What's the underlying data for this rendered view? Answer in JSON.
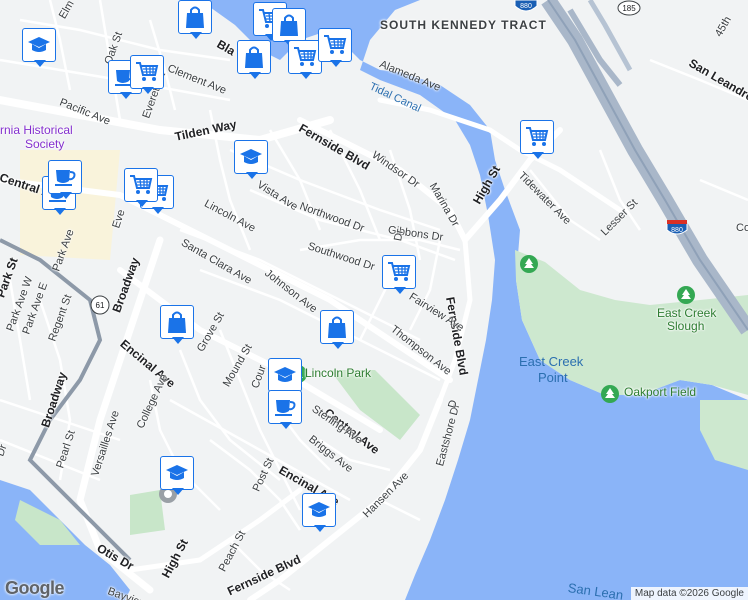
{
  "map": {
    "attribution": "Map data ©2026 Google",
    "logo": "Google",
    "colors": {
      "water": "#8ab4f8",
      "land": "#f1f3f4",
      "park": "#c8e6c9",
      "freeway": "#a9b7c9",
      "road": "#ffffff",
      "marker": "#1a73e8"
    }
  },
  "labels": {
    "district": "SOUTH KENNEDY TRACT",
    "historical_1": "rnia Historical",
    "historical_2": "Society",
    "tidal_canal": "Tidal Canal",
    "east_creek_point_1": "East Creek",
    "east_creek_point_2": "Point",
    "east_creek_slough_1": "East Creek",
    "east_creek_slough_2": "Slough",
    "oakport_field": "Oakport Field",
    "lincoln_park": "Lincoln Park",
    "san_leandro_bottom": "San Lean",
    "elm": "Elm St",
    "oak": "Oak St",
    "clement": "Clement Ave",
    "everett_top": "Everett St",
    "pacific": "Pacific Ave",
    "blanding": "Bla",
    "alameda_ave": "Alameda Ave",
    "tilden": "Tilden Way",
    "fernside_top": "Fernside Blvd",
    "windsor": "Windsor Dr",
    "marina": "Marina Dr",
    "high_st_right": "High St",
    "high_st_bottom": "High St",
    "tidewater": "Tidewater Ave",
    "lesser": "Lesser St",
    "san_leandro_top": "San Leandro S",
    "street_45th": "45th",
    "central_left": "Central Av",
    "central_bottom": "Central Ave",
    "vista": "Vista Ave",
    "northwood": "Northwood Dr",
    "gibbons": "Gibbons Dr",
    "southwood": "Southwood Dr",
    "dr_small": "Dr",
    "lincoln": "Lincoln Ave",
    "everett_mid": "Eve",
    "santa_clara": "Santa Clara Ave",
    "johnson": "Johnson Ave",
    "fernside_right": "Fernside Blvd",
    "fairview": "Fairview Ave",
    "thompson": "Thompson Ave",
    "park_st": "Park St",
    "park_ave": "Park Ave",
    "park_ave_w": "Park Ave W",
    "park_ave_e": "Park Ave E",
    "regent": "Regent St",
    "broadway_top": "Broadway",
    "broadway_left": "Broadway",
    "encinal_left": "Encinal Ave",
    "encinal_bottom": "Encinal Ave",
    "grove": "Grove St",
    "mound": "Mound St",
    "college": "College Ave",
    "versailles": "Versailles Ave",
    "pearl": "Pearl St",
    "sterling": "Sterling Ave",
    "briggs": "Briggs Ave",
    "court": "Cour",
    "post": "Post St",
    "peach": "Peach St",
    "hansen": "Hansen Ave",
    "eastshore": "Eastshore Dr",
    "otis": "Otis Dr",
    "bayview": "Bayview Dr",
    "fernside_bottom": "Fernside Blvd",
    "dr_left": "Dr",
    "dr_right": "D",
    "co": "Co",
    "shield_880_top": "880",
    "shield_880_right": "880",
    "shield_185": "185",
    "shield_61": "61"
  },
  "markers": [
    {
      "kind": "shopping-cart",
      "stack": 1
    },
    {
      "kind": "shopping-bag",
      "stack": 1
    },
    {
      "kind": "coffee",
      "stack": 1
    },
    {
      "kind": "school",
      "stack": 1
    },
    {
      "kind": "shopping-cart",
      "stack": 1
    },
    {
      "kind": "shopping-bag",
      "stack": 1
    },
    {
      "kind": "shopping-cart",
      "stack": 1
    },
    {
      "kind": "school",
      "stack": 1
    },
    {
      "kind": "coffee",
      "stack": 1
    },
    {
      "kind": "shopping-cart",
      "stack": 1
    },
    {
      "kind": "coffee",
      "stack": 1
    },
    {
      "kind": "shopping-cart",
      "stack": 1
    },
    {
      "kind": "shopping-cart",
      "stack": 1
    },
    {
      "kind": "shopping-cart",
      "stack": 1
    },
    {
      "kind": "shopping-bag",
      "stack": 1
    },
    {
      "kind": "shopping-bag",
      "stack": 1
    },
    {
      "kind": "school",
      "stack": 1
    },
    {
      "kind": "coffee",
      "stack": 1
    },
    {
      "kind": "school",
      "stack": 1
    },
    {
      "kind": "school",
      "stack": 1
    },
    {
      "kind": "shopping-bag",
      "stack": 1
    },
    {
      "kind": "shopping-cart",
      "stack": 1
    }
  ]
}
